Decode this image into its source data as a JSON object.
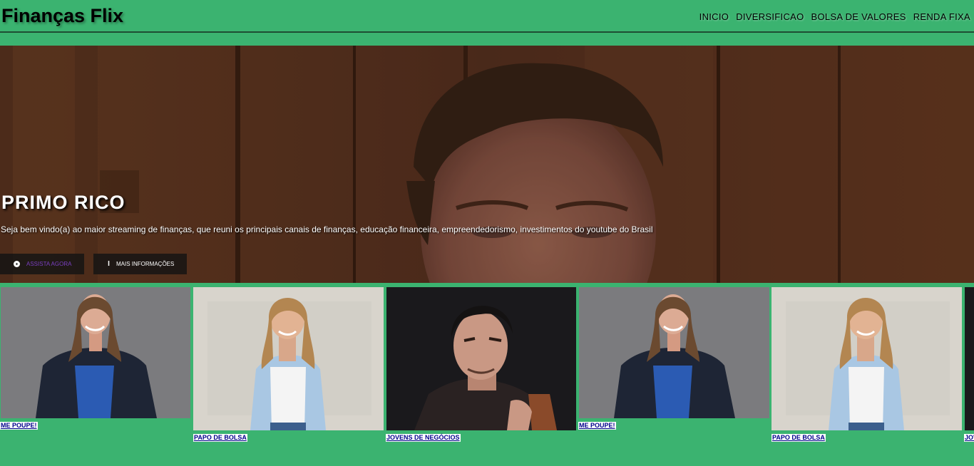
{
  "header": {
    "site_title": "Finanças Flix",
    "nav": [
      "INICIO",
      "DIVERSIFICAO",
      "BOLSA DE VALORES",
      "RENDA FIXA"
    ]
  },
  "hero": {
    "title": "PRIMO RICO",
    "description": "Seja bem vindo(a) ao maior streaming de finanças, que reuni os principais canais de finanças, educação financeira, empreendedorismo, investimentos do youtube do Brasil",
    "watch_label": "ASSISTA AGORA",
    "info_label": "MAIS INFORMAÇÕES"
  },
  "channels": [
    {
      "label": "ME POUPE!"
    },
    {
      "label": "PAPO DE BOLSA"
    },
    {
      "label": "JOVENS DE NEGÓCIOS"
    },
    {
      "label": "ME POUPE!"
    },
    {
      "label": "PAPO DE BOLSA"
    },
    {
      "label": "JOVENS DE NEGÓCIOS"
    }
  ],
  "colors": {
    "background": "#3bb370",
    "link": "#00008b",
    "watch_button_text": "#7a3fc0"
  }
}
